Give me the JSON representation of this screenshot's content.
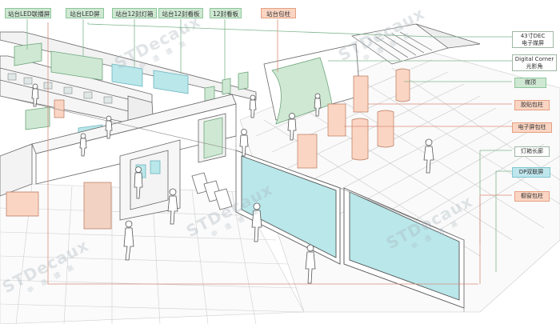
{
  "top_labels": [
    {
      "id": "platform-led-joint-screen",
      "text": "站台LED联播屏",
      "color": "green"
    },
    {
      "id": "platform-led-screen",
      "text": "站台LED屏",
      "color": "green"
    },
    {
      "id": "platform-12-lightbox",
      "text": "站台12封灯箱",
      "color": "green"
    },
    {
      "id": "platform-12-panel",
      "text": "站台12封看板",
      "color": "green"
    },
    {
      "id": "12-panel",
      "text": "12封看板",
      "color": "green"
    },
    {
      "id": "platform-column-wrap",
      "text": "站台包柱",
      "color": "orange"
    }
  ],
  "right_labels": [
    {
      "id": "dec-43-digital-screen",
      "lines": [
        "43寸DEC",
        "电子媒屏"
      ],
      "color": "white"
    },
    {
      "id": "digital-corner",
      "lines": [
        "Digital Corner",
        "光影角"
      ],
      "color": "white"
    },
    {
      "id": "stairs",
      "lines": [
        "梯顶"
      ],
      "color": "green"
    },
    {
      "id": "glue-column",
      "lines": [
        "胶贴包柱"
      ],
      "color": "orange"
    },
    {
      "id": "e-screen-column",
      "lines": [
        "电子屏包柱"
      ],
      "color": "orange"
    },
    {
      "id": "lightbox-corridor",
      "lines": [
        "灯箱长廊"
      ],
      "color": "white"
    },
    {
      "id": "dp-double-screen",
      "lines": [
        "DP双联屏"
      ],
      "color": "blue"
    },
    {
      "id": "window-column",
      "lines": [
        "橱窗包柱"
      ],
      "color": "orange"
    }
  ],
  "watermark": {
    "brand": "STDecaux",
    "sub": "申 通 德 高"
  },
  "colors": {
    "green_fill": "#cfe8d3",
    "green_line": "#8cc79a",
    "orange_fill": "#fbd5c3",
    "orange_line": "#e4a081",
    "blue_fill": "#bfe6ec",
    "screen_fill": "#b9e7ea",
    "pink_leader": "#d98c7a",
    "green_leader": "#7fb78d",
    "ink": "#555555"
  }
}
